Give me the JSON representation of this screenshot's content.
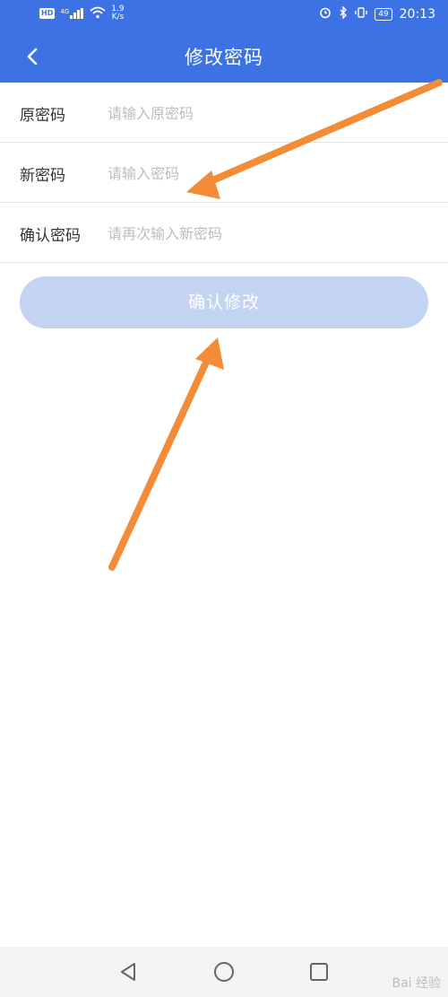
{
  "status_bar": {
    "hd": "HD",
    "network": "4G",
    "speed_value": "1.9",
    "speed_unit": "K/s",
    "battery": "49",
    "time": "20:13"
  },
  "app_bar": {
    "title": "修改密码"
  },
  "form": {
    "old_password": {
      "label": "原密码",
      "placeholder": "请输入原密码"
    },
    "new_password": {
      "label": "新密码",
      "placeholder": "请输入密码"
    },
    "confirm_password": {
      "label": "确认密码",
      "placeholder": "请再次输入新密码"
    }
  },
  "confirm_button": {
    "label": "确认修改"
  },
  "watermark": "Bai 经验",
  "colors": {
    "primary": "#3d72e4",
    "button_disabled": "#c3d4f3",
    "annotation_arrow": "#f28c38"
  }
}
